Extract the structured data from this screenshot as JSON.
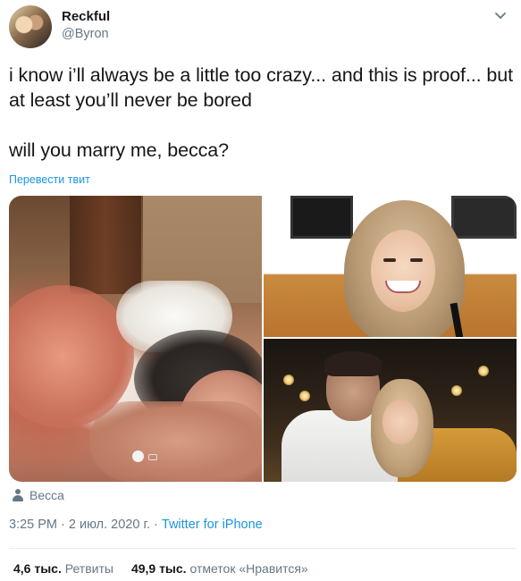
{
  "author": {
    "display_name": "Reckful",
    "handle": "@Byron"
  },
  "tweet": {
    "text": "i know i’ll always be a little too crazy... and this is proof... but at least you’ll never be bored\n\nwill you marry me, becca?",
    "translate_label": "Перевести твит"
  },
  "media": {
    "tagged_person": "Becca",
    "photos": [
      "video-still-bed",
      "portrait-smiling",
      "couple-restaurant"
    ]
  },
  "meta": {
    "time": "3:25 PM",
    "separator": " · ",
    "date": "2 июл. 2020 г.",
    "source": "Twitter for iPhone"
  },
  "stats": {
    "retweets_count": "4,6 тыс.",
    "retweets_label": "Ретвиты",
    "likes_count": "49,9 тыс.",
    "likes_label": "отметок «Нравится»"
  },
  "icons": {
    "caret": "chevron-down-icon",
    "person": "person-icon"
  },
  "colors": {
    "link": "#1b95e0",
    "muted": "#657786",
    "text": "#14171a"
  }
}
